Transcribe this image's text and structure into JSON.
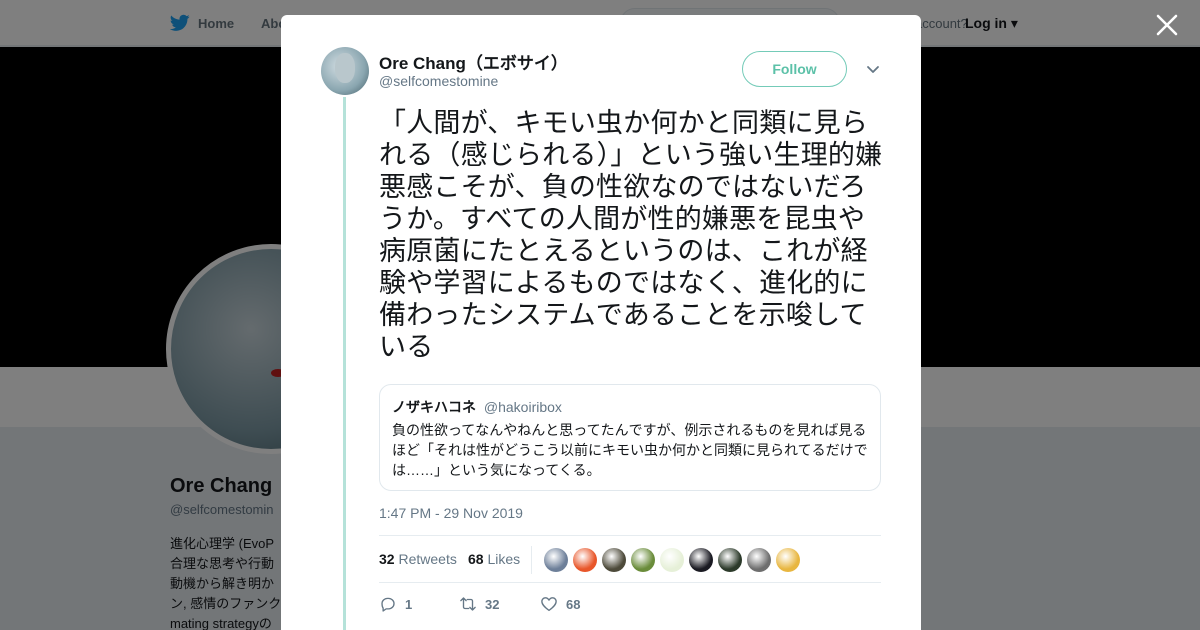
{
  "background": {
    "nav_home": "Home",
    "nav_about": "Abo",
    "have_account": "account?",
    "login": "Log in",
    "profile_name": "Ore Chang",
    "profile_handle": "@selfcomestomin",
    "bio_lines": [
      "進化心理学 (EvoP",
      "合理な思考や行動",
      "動機から解き明か",
      "ン, 感情のファンク",
      "mating strategyの"
    ]
  },
  "tweet": {
    "author_name": "Ore Chang（エボサイ）",
    "author_handle": "@selfcomestomine",
    "follow_label": "Follow",
    "text": "「人間が、キモい虫か何かと同類に見られる（感じられる）」という強い生理的嫌悪感こそが、負の性欲なのではないだろうか。すべての人間が性的嫌悪を昆虫や病原菌にたとえるというのは、これが経験や学習によるものではなく、進化的に備わったシステムであることを示唆している",
    "timestamp": "1:47 PM - 29 Nov 2019",
    "quote": {
      "name": "ノザキハコネ",
      "handle": "@hakoiribox",
      "text": "負の性欲ってなんやねんと思ってたんですが、例示されるものを見れば見るほど「それは性がどうこう以前にキモい虫か何かと同類に見られてるだけでは……」という気になってくる。"
    },
    "stats": {
      "retweets_count": "32",
      "retweets_label": "Retweets",
      "likes_count": "68",
      "likes_label": "Likes"
    },
    "liker_avatar_colors": [
      "#6d7f99",
      "#e8562a",
      "#4d4a3a",
      "#6a8c3a",
      "#e6f0d8",
      "#1a1a22",
      "#2c3a2a",
      "#6e6e6e",
      "#e8b640"
    ],
    "actions": {
      "replies": "1",
      "retweets": "32",
      "likes": "68"
    }
  },
  "colors": {
    "accent": "#74cbb8",
    "thread_line": "#b5e2d9",
    "twitter_blue": "#1da1f2"
  }
}
